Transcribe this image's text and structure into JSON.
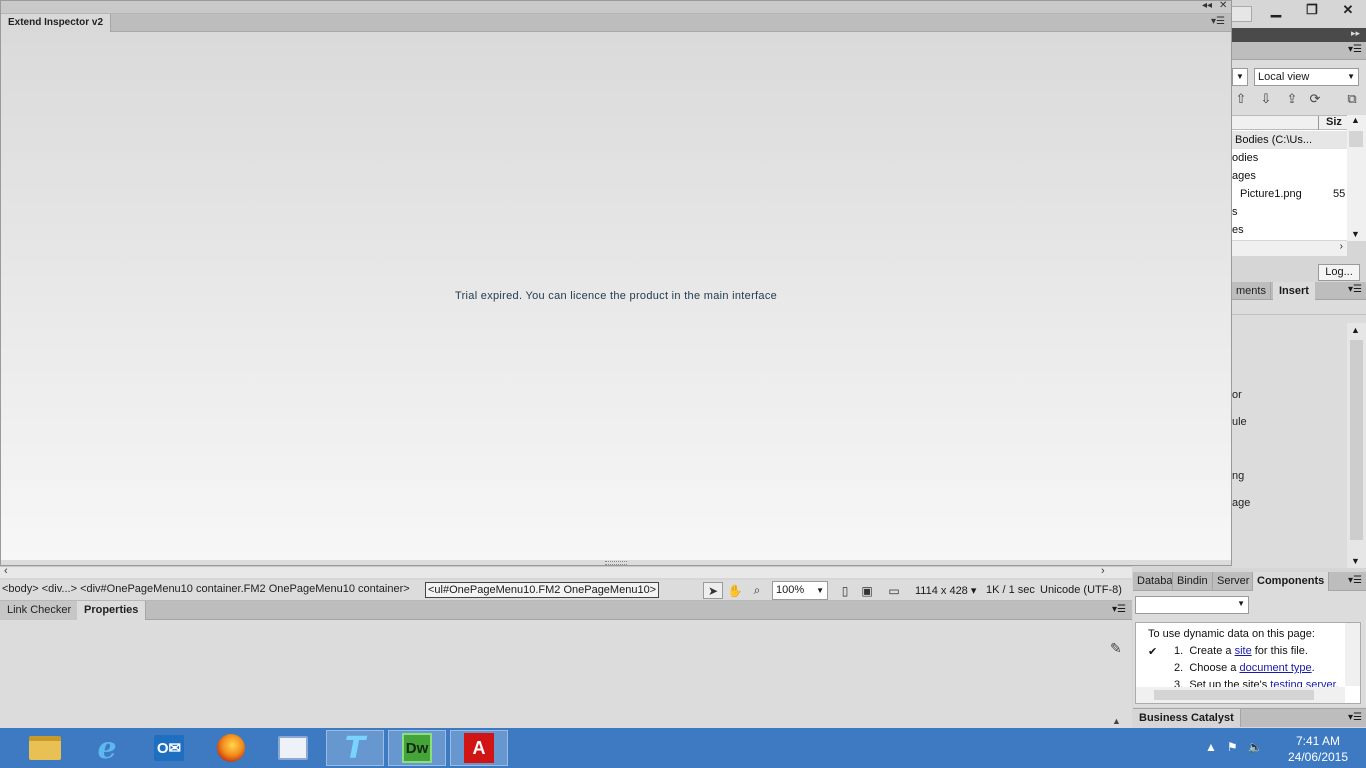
{
  "window_controls": {
    "minimize": "▁",
    "restore": "❐",
    "close": "✕"
  },
  "inspector": {
    "title": "Extend Inspector v2",
    "collapse_glyph": "◂◂",
    "close_glyph": "✕",
    "menu_glyph": "▾☰",
    "message": "Trial expired. You can licence the product in the main interface"
  },
  "tag_selector": {
    "path": "<body> <div...> <div#OnePageMenu10  container.FM2  OnePageMenu10  container>",
    "active": "<ul#OnePageMenu10.FM2  OnePageMenu10>"
  },
  "status": {
    "zoom": "100%",
    "size": "1114 x 428 ▾",
    "speed": "1K / 1 sec",
    "encoding": "Unicode (UTF-8)"
  },
  "properties_panel": {
    "tabs": [
      "Link Checker",
      "Properties"
    ],
    "active_tab": "Properties"
  },
  "files_panel": {
    "view": "Local view",
    "size_header": "Siz",
    "rows": [
      {
        "name": "Bodies (C:\\Us...",
        "size": ""
      },
      {
        "name": "odies",
        "size": ""
      },
      {
        "name": "ages",
        "size": ""
      },
      {
        "name": "Picture1.png",
        "size": "55"
      },
      {
        "name": "s",
        "size": ""
      },
      {
        "name": "es",
        "size": ""
      }
    ],
    "log_button": "Log..."
  },
  "insert_panel": {
    "tabs": [
      "ments",
      "Insert"
    ],
    "items": [
      "or",
      "ule",
      "ng",
      "age"
    ]
  },
  "components_panel": {
    "tabs": [
      "Databa",
      "Bindin",
      "Server",
      "Components"
    ],
    "active_tab": "Components",
    "intro": "To use dynamic data on this page:",
    "steps": [
      {
        "num": "1.",
        "pre": "Create a ",
        "link": "site",
        "post": " for this file.",
        "check": "✔"
      },
      {
        "num": "2.",
        "pre": "Choose a ",
        "link": "document type",
        "post": ".",
        "check": ""
      },
      {
        "num": "3.",
        "pre": "Set up the site's ",
        "link": "testing server",
        "post": ".",
        "check": ""
      }
    ]
  },
  "business_catalyst": {
    "title": "Business Catalyst"
  },
  "taskbar": {
    "apps": [
      {
        "name": "File Explorer",
        "icon": "folder-icon"
      },
      {
        "name": "Internet Explorer",
        "icon": "ie-icon"
      },
      {
        "name": "Outlook",
        "icon": "outlook-icon"
      },
      {
        "name": "Firefox",
        "icon": "firefox-icon"
      },
      {
        "name": "Control Panel",
        "icon": "control-panel-icon"
      },
      {
        "name": "Telstra",
        "icon": "telstra-icon"
      },
      {
        "name": "Dreamweaver",
        "icon": "dreamweaver-icon"
      },
      {
        "name": "Acrobat",
        "icon": "acrobat-icon"
      }
    ],
    "ie_glyph": "e",
    "outlook_glyph": "O✉",
    "telstra_glyph": "T",
    "dw_glyph": "Dw",
    "acrobat_glyph": "A",
    "time": "7:41 AM",
    "date": "24/06/2015"
  },
  "colors": {
    "taskbar": "#3d7ac2",
    "panel_bg": "#dcdcdc",
    "message_text": "#1e3a4e"
  }
}
